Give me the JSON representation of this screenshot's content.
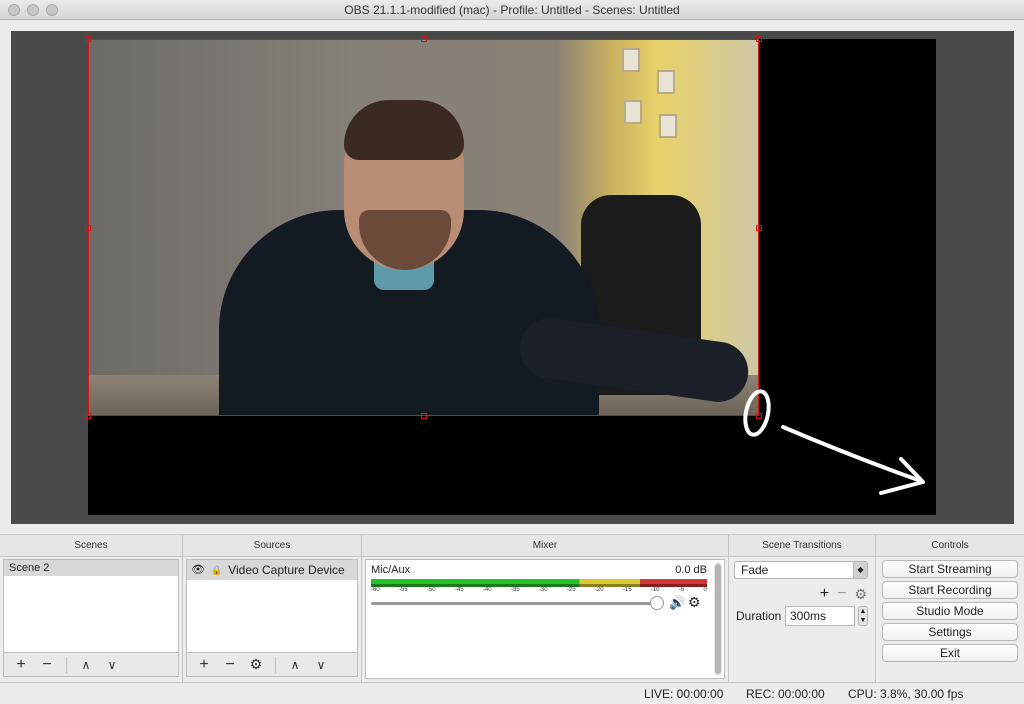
{
  "window": {
    "title": "OBS 21.1.1-modified (mac) - Profile: Untitled - Scenes: Untitled"
  },
  "scenes": {
    "header": "Scenes",
    "items": [
      "Scene 2"
    ]
  },
  "sources": {
    "header": "Sources",
    "items": [
      "Video Capture Device"
    ]
  },
  "mixer": {
    "header": "Mixer",
    "channel": "Mic/Aux",
    "level": "0.0 dB",
    "ticks": [
      "-60",
      "-55",
      "-50",
      "-45",
      "-40",
      "-35",
      "-30",
      "-25",
      "-20",
      "-15",
      "-10",
      "-5",
      "0"
    ],
    "volume_fraction": 1.0
  },
  "transitions": {
    "header": "Scene Transitions",
    "selected": "Fade",
    "duration_label": "Duration",
    "duration_value": "300ms"
  },
  "controls": {
    "header": "Controls",
    "buttons": [
      "Start Streaming",
      "Start Recording",
      "Studio Mode",
      "Settings",
      "Exit"
    ]
  },
  "status": {
    "live": "LIVE: 00:00:00",
    "rec": "REC: 00:00:00",
    "cpu": "CPU: 3.8%, 30.00 fps"
  },
  "icons": {
    "add": "+",
    "remove": "−",
    "up": "∧",
    "down": "∨",
    "gear": "⚙",
    "eye": "👁",
    "lock": "🔒",
    "speaker": "🔊"
  },
  "colors": {
    "selection_border": "#d01818",
    "meter_green": "#27c227",
    "meter_yellow": "#d9c930",
    "meter_red": "#d23a3a"
  }
}
